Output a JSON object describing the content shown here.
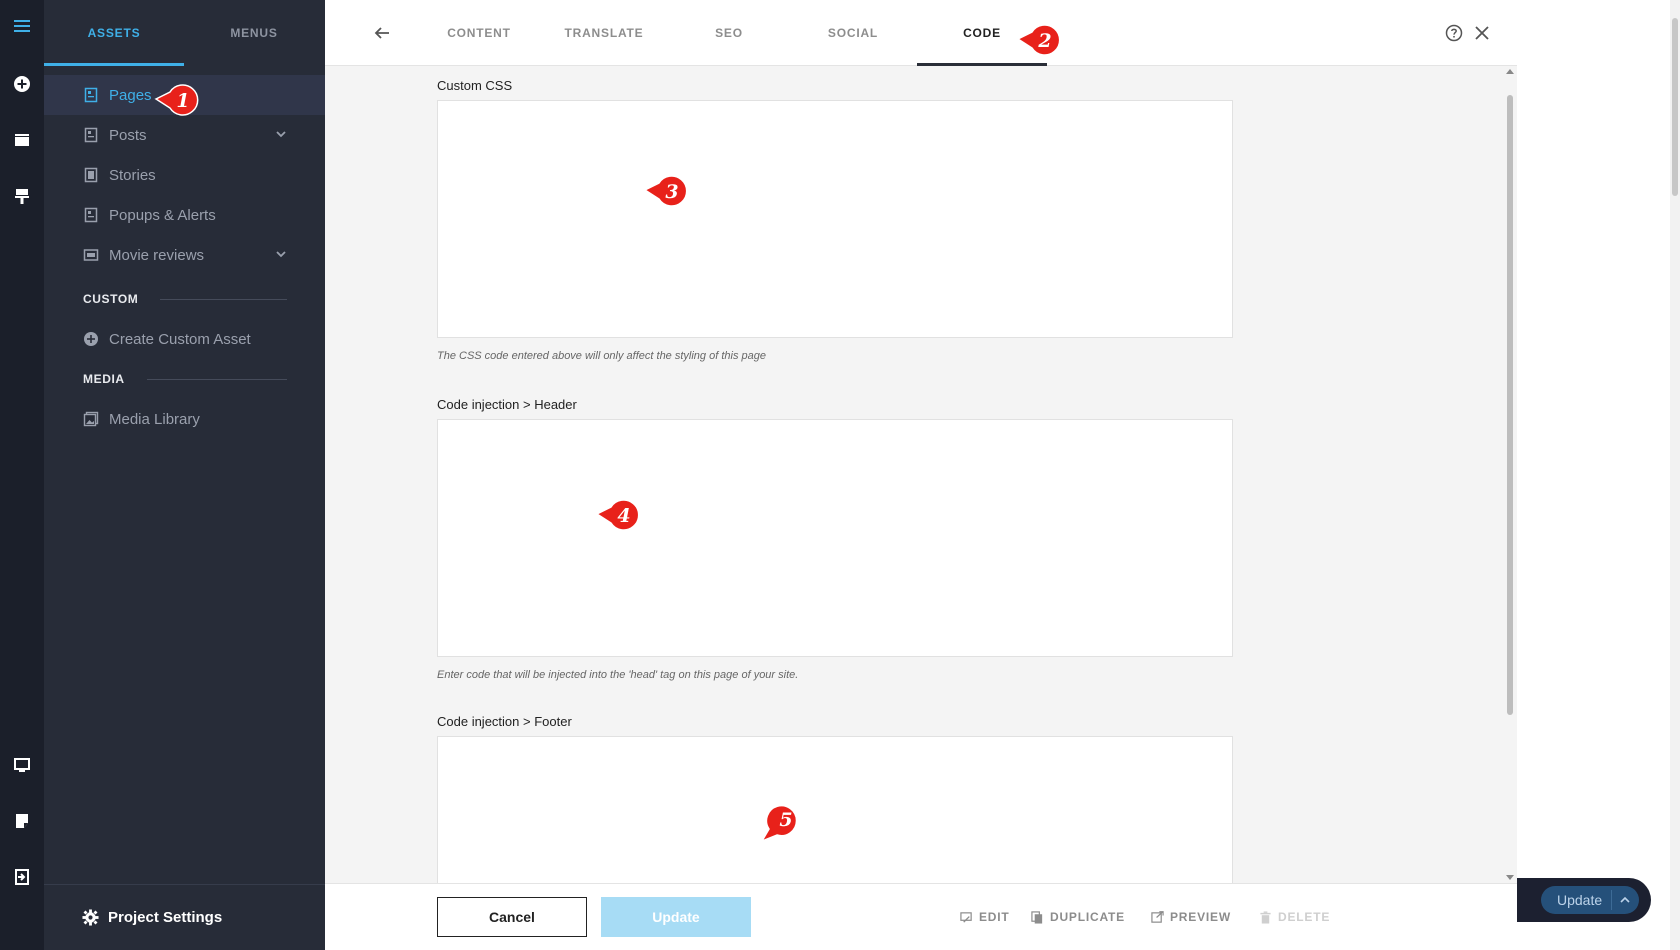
{
  "colors": {
    "accent": "#3fb0e8",
    "rail_bg": "#1b1f2a",
    "sidebar_bg": "#272c38",
    "panel_bg": "#f4f4f4",
    "marker": "#e8211a",
    "update_disabled": "#a7dcf5"
  },
  "rail": {
    "icons": [
      "hamburger-menu-icon",
      "add-circle-icon",
      "folder-icon",
      "brush-icon",
      "desktop-icon",
      "note-icon",
      "exit-icon"
    ]
  },
  "sidebar": {
    "tabs": [
      {
        "label": "ASSETS",
        "active": true
      },
      {
        "label": "MENUS",
        "active": false
      }
    ],
    "items": [
      {
        "label": "Pages",
        "icon": "page-icon",
        "active": true
      },
      {
        "label": "Posts",
        "icon": "page-icon",
        "expandable": true
      },
      {
        "label": "Stories",
        "icon": "page-icon"
      },
      {
        "label": "Popups & Alerts",
        "icon": "page-icon"
      },
      {
        "label": "Movie reviews",
        "icon": "ticket-icon",
        "expandable": true
      }
    ],
    "section_custom": "CUSTOM",
    "create_custom": "Create Custom Asset",
    "section_media": "MEDIA",
    "media_library": "Media Library",
    "footer": "Project Settings"
  },
  "editor": {
    "tabs": [
      {
        "label": "CONTENT",
        "active": false
      },
      {
        "label": "TRANSLATE",
        "active": false
      },
      {
        "label": "SEO",
        "active": false
      },
      {
        "label": "SOCIAL",
        "active": false
      },
      {
        "label": "CODE",
        "active": true
      }
    ],
    "fields": [
      {
        "label": "Custom CSS",
        "value": "",
        "hint": "The CSS code entered above will only affect the styling of this page"
      },
      {
        "label": "Code injection > Header",
        "value": "",
        "hint": "Enter code that will be injected into the 'head' tag on this page of your site."
      },
      {
        "label": "Code injection > Footer",
        "value": ""
      }
    ],
    "cancel_label": "Cancel",
    "update_label": "Update",
    "actions": [
      {
        "label": "EDIT",
        "icon": "edit-icon",
        "enabled": true
      },
      {
        "label": "DUPLICATE",
        "icon": "duplicate-icon",
        "enabled": true
      },
      {
        "label": "PREVIEW",
        "icon": "external-link-icon",
        "enabled": true
      },
      {
        "label": "DELETE",
        "icon": "trash-icon",
        "enabled": false
      }
    ]
  },
  "background": {
    "update_label": "Update"
  },
  "markers": [
    "1",
    "2",
    "3",
    "4",
    "5"
  ]
}
